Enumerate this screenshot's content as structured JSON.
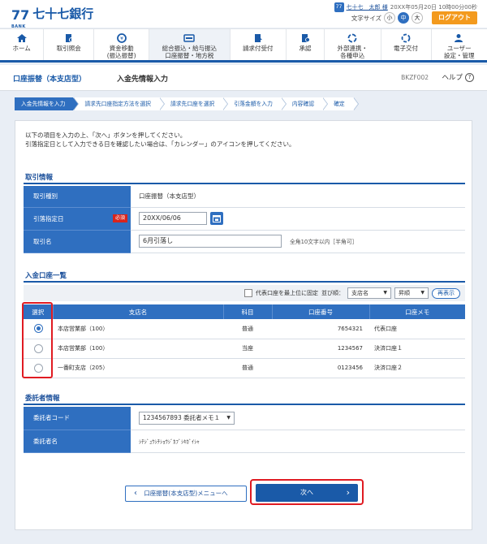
{
  "header": {
    "logo_mark": "77",
    "logo_sub": "BANK",
    "bank_name": "七十七銀行",
    "user_name": "七十七　太郎 様",
    "last_login": "20XX年05月20日 10時00分00秒",
    "font_size_label": "文字サイズ",
    "font_small": "小",
    "font_medium": "中",
    "font_large": "大",
    "logout": "ログアウト"
  },
  "nav": [
    {
      "label1": "ホーム",
      "label2": "",
      "icon": "home-icon"
    },
    {
      "label1": "取引照会",
      "label2": "",
      "icon": "search-doc-icon"
    },
    {
      "label1": "資金移動",
      "label2": "(振込振替)",
      "icon": "money-transfer-icon"
    },
    {
      "label1": "総合振込・給与振込",
      "label2": "口座振替・地方税",
      "icon": "bulk-transfer-icon"
    },
    {
      "label1": "請求付受付",
      "label2": "",
      "icon": "invoice-icon"
    },
    {
      "label1": "承認",
      "label2": "",
      "icon": "approval-icon"
    },
    {
      "label1": "外部連携・",
      "label2": "各種申込",
      "icon": "link-icon"
    },
    {
      "label1": "電子交付",
      "label2": "",
      "icon": "e-delivery-icon"
    },
    {
      "label1": "ユーザー",
      "label2": "設定・管理",
      "icon": "user-settings-icon"
    }
  ],
  "title": {
    "section": "口座振替（本支店型）",
    "page": "入金先情報入力",
    "code": "BKZF002",
    "help": "ヘルプ"
  },
  "steps": [
    "入金先情報を入力",
    "請求先口座指定方法を選択",
    "請求先口座を選択",
    "引落金額を入力",
    "内容確認",
    "確定"
  ],
  "intro": {
    "line1": "以下の項目を入力の上、「次へ」ボタンを押してください。",
    "line2": "引落指定日として入力できる日を確認したい場合は、「カレンダー」のアイコンを押してください。"
  },
  "transaction": {
    "section_title": "取引情報",
    "type_label": "取引種別",
    "type_value": "口座振替（本支店型）",
    "date_label": "引落指定日",
    "required": "必須",
    "date_value": "20XX/06/06",
    "name_label": "取引名",
    "name_value": "6月引落し",
    "name_hint": "全角10文字以内［半角可］"
  },
  "accounts": {
    "section_title": "入金口座一覧",
    "rep_first": "代表口座を最上位に固定",
    "sort_label": "並び順：",
    "sort_key": "支店名",
    "sort_order": "昇順",
    "redisplay": "再表示",
    "headers": [
      "選択",
      "支店名",
      "科目",
      "口座番号",
      "口座メモ"
    ],
    "rows": [
      {
        "branch": "本店営業部（100）",
        "type": "普通",
        "number": "7654321",
        "memo": "代表口座",
        "selected": true
      },
      {
        "branch": "本店営業部（100）",
        "type": "当座",
        "number": "1234567",
        "memo": "決済口座１",
        "selected": false
      },
      {
        "branch": "一番町支店（205）",
        "type": "普通",
        "number": "0123456",
        "memo": "決済口座２",
        "selected": false
      }
    ]
  },
  "consignor": {
    "section_title": "委託者情報",
    "code_label": "委託者コード",
    "code_value": "1234567893 委託者メモ１",
    "name_label": "委託者名",
    "name_value": "ｼﾁｼﾞｭｳｼﾁｼｮｳｼﾞｶﾌﾞｼｷｶﾞｲｼｬ"
  },
  "buttons": {
    "back": "口座振替(本支店型)メニューへ",
    "next": "次へ"
  }
}
